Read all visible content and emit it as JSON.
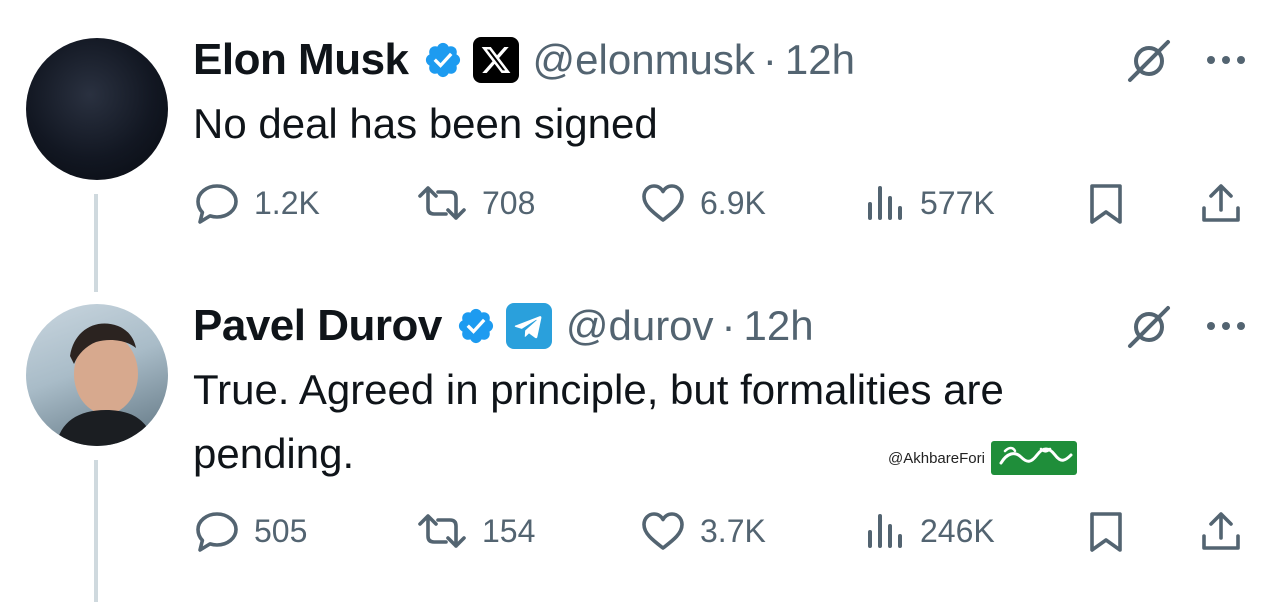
{
  "tweets": [
    {
      "name": "Elon Musk",
      "handle": "@elonmusk",
      "dot": "·",
      "time": "12h",
      "brand": "x",
      "text": "No deal has been signed",
      "stats": {
        "replies": "1.2K",
        "retweets": "708",
        "likes": "6.9K",
        "views": "577K"
      }
    },
    {
      "name": "Pavel Durov",
      "handle": "@durov",
      "dot": "·",
      "time": "12h",
      "brand": "telegram",
      "text": "True. Agreed in principle, but formalities are pending.",
      "stats": {
        "replies": "505",
        "retweets": "154",
        "likes": "3.7K",
        "views": "246K"
      }
    }
  ],
  "watermark": {
    "handle": "@AkhbareFori"
  },
  "icons": [
    "verified-badge-icon",
    "x-logo-icon",
    "telegram-logo-icon",
    "grok-icon",
    "more-icon",
    "reply-icon",
    "retweet-icon",
    "like-icon",
    "views-icon",
    "bookmark-icon",
    "share-icon"
  ],
  "colors": {
    "verified": "#1d9bf0",
    "muted": "#536471",
    "text": "#0f1419",
    "telegram": "#2aa0dc",
    "thread_line": "#cfd9de"
  }
}
